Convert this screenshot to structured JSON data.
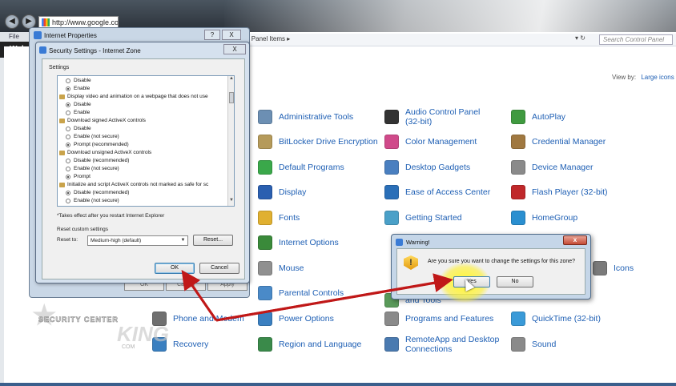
{
  "browser": {
    "url": "http://www.google.com",
    "menu_file": "File",
    "web_tab": "Web"
  },
  "control_panel": {
    "breadcrumb": "ntrol Panel Items ▸",
    "search_placeholder": "Search Control Panel",
    "view_by_label": "View by:",
    "view_by_value": "Large icons ▾",
    "items": [
      {
        "label": "Administrative Tools",
        "icon": "admin-tools-icon",
        "color": "#6c8fb3"
      },
      {
        "label": "Audio Control Panel\n(32-bit)",
        "icon": "audio-icon",
        "color": "#333333"
      },
      {
        "label": "AutoPlay",
        "icon": "autoplay-icon",
        "color": "#3f9a3f"
      },
      {
        "label": "BitLocker Drive Encryption",
        "icon": "key-icon",
        "color": "#b59a5a"
      },
      {
        "label": "Color Management",
        "icon": "color-icon",
        "color": "#d04a8a"
      },
      {
        "label": "Credential Manager",
        "icon": "credential-icon",
        "color": "#a07840"
      },
      {
        "label": "Default Programs",
        "icon": "default-programs-icon",
        "color": "#3aa84a"
      },
      {
        "label": "Desktop Gadgets",
        "icon": "gadgets-icon",
        "color": "#4a7fc0"
      },
      {
        "label": "Device Manager",
        "icon": "device-manager-icon",
        "color": "#8a8a8a"
      },
      {
        "label": "Display",
        "icon": "display-icon",
        "color": "#2a5fb0"
      },
      {
        "label": "Ease of Access Center",
        "icon": "ease-access-icon",
        "color": "#2a6fb8"
      },
      {
        "label": "Flash Player (32-bit)",
        "icon": "flash-icon",
        "color": "#c0282a"
      },
      {
        "label": "Fonts",
        "icon": "fonts-icon",
        "color": "#e0b030"
      },
      {
        "label": "Getting Started",
        "icon": "getting-started-icon",
        "color": "#4aa0c8"
      },
      {
        "label": "HomeGroup",
        "icon": "homegroup-icon",
        "color": "#2a8fd0"
      },
      {
        "label": "Internet Options",
        "icon": "internet-options-icon",
        "color": "#3a8a3a"
      },
      {
        "label": "Mouse",
        "icon": "mouse-icon",
        "color": "#909090"
      },
      {
        "label": "Parental Controls",
        "icon": "parental-icon",
        "color": "#4a8ac8"
      },
      {
        "label": "and Tools",
        "icon": "performance-icon",
        "color": "#5a9a5a"
      },
      {
        "label": "Icons",
        "icon": "notification-icon",
        "color": "#7a7a7a"
      },
      {
        "label": "Phone and Modem",
        "icon": "phone-icon",
        "color": "#707070"
      },
      {
        "label": "Power Options",
        "icon": "power-icon",
        "color": "#3a7fc0"
      },
      {
        "label": "Programs and Features",
        "icon": "programs-icon",
        "color": "#8a8a8a"
      },
      {
        "label": "QuickTime (32-bit)",
        "icon": "quicktime-icon",
        "color": "#3a9ad8"
      },
      {
        "label": "Recovery",
        "icon": "recovery-icon",
        "color": "#3a7fc0"
      },
      {
        "label": "Region and Language",
        "icon": "region-icon",
        "color": "#3a8a4a"
      },
      {
        "label": "RemoteApp and Desktop\nConnections",
        "icon": "remoteapp-icon",
        "color": "#4a7ab0"
      },
      {
        "label": "Sound",
        "icon": "sound-icon",
        "color": "#8a8a8a"
      }
    ]
  },
  "internet_properties": {
    "title": "Internet Properties",
    "help": "?",
    "close": "X",
    "ok": "OK",
    "cancel": "Cancel",
    "apply": "Apply"
  },
  "security_settings": {
    "title": "Security Settings - Internet Zone",
    "close": "X",
    "settings_label": "Settings",
    "rows": [
      {
        "text": "Disable",
        "kind": "opt",
        "checked": false
      },
      {
        "text": "Enable",
        "kind": "opt",
        "checked": true
      },
      {
        "text": "Display video and animation on a webpage that does not use",
        "kind": "hdr"
      },
      {
        "text": "Disable",
        "kind": "opt",
        "checked": true
      },
      {
        "text": "Enable",
        "kind": "opt",
        "checked": false
      },
      {
        "text": "Download signed ActiveX controls",
        "kind": "hdr"
      },
      {
        "text": "Disable",
        "kind": "opt",
        "checked": false
      },
      {
        "text": "Enable (not secure)",
        "kind": "opt",
        "checked": false
      },
      {
        "text": "Prompt (recommended)",
        "kind": "opt",
        "checked": true
      },
      {
        "text": "Download unsigned ActiveX controls",
        "kind": "hdr"
      },
      {
        "text": "Disable (recommended)",
        "kind": "opt",
        "checked": false
      },
      {
        "text": "Enable (not secure)",
        "kind": "opt",
        "checked": false
      },
      {
        "text": "Prompt",
        "kind": "opt",
        "checked": true
      },
      {
        "text": "Initialize and script ActiveX controls not marked as safe for sc",
        "kind": "hdr"
      },
      {
        "text": "Disable (recommended)",
        "kind": "opt",
        "checked": true
      },
      {
        "text": "Enable (not secure)",
        "kind": "opt",
        "checked": false
      }
    ],
    "note": "*Takes effect after you restart Internet Explorer",
    "reset_custom_label": "Reset custom settings",
    "reset_to_label": "Reset to:",
    "reset_to_value": "Medium-high (default)",
    "reset_button": "Reset...",
    "ok": "OK",
    "cancel": "Cancel"
  },
  "warning": {
    "title": "Warning!",
    "close": "x",
    "icon_glyph": "!",
    "message": "Are you sure you want to change the settings for this zone?",
    "yes": "Yes",
    "no": "No"
  },
  "watermark": {
    "big": "★",
    "small": "SECURITY CENTER",
    "king": "KING",
    "tag": "COM"
  },
  "annotation_color": "#c01818"
}
